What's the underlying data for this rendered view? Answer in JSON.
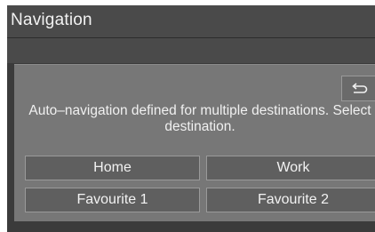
{
  "header": {
    "title": "Navigation"
  },
  "dialog": {
    "message_line1": "Auto–navigation defined for multiple destinations. Select",
    "message_line2": "destination.",
    "back_icon": "back-arrow-icon"
  },
  "destinations": {
    "home": "Home",
    "work": "Work",
    "favourite1": "Favourite 1",
    "favourite2": "Favourite 2"
  },
  "colors": {
    "screen_bg": "#3b3b3b",
    "panel_bg": "#777777",
    "button_bg": "#5f5f5f",
    "text": "#f2f2f2"
  }
}
